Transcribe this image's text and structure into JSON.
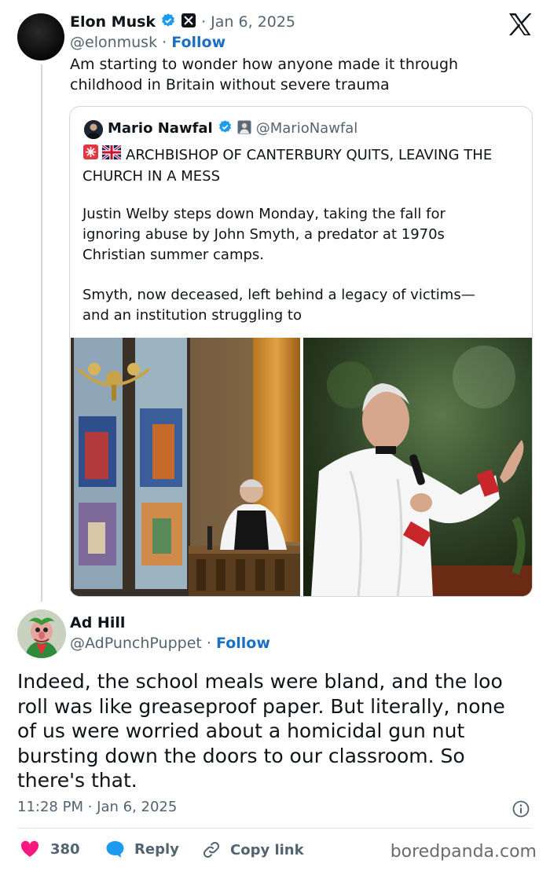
{
  "main_tweet": {
    "name": "Elon Musk",
    "date": "· Jan 6, 2025",
    "handle": "@elonmusk",
    "separator": "·",
    "follow_label": "Follow",
    "text_line1": "Am starting to wonder how anyone made it through",
    "text_line2": "childhood in Britain without severe trauma"
  },
  "quoted_tweet": {
    "name": "Mario Nawfal",
    "handle": "@MarioNawfal",
    "headline_line1": "ARCHBISHOP OF CANTERBURY QUITS, LEAVING THE",
    "headline_line2": "CHURCH IN A MESS",
    "para1_line1": "Justin Welby steps down Monday, taking the fall for",
    "para1_line2": "ignoring abuse by John Smyth, a predator at 1970s",
    "para1_line3": "Christian summer camps.",
    "para2_line1": "Smyth, now deceased, left behind a legacy of victims—",
    "para2_line2": "and an institution struggling to"
  },
  "reply_tweet": {
    "name": "Ad Hill",
    "handle": "@AdPunchPuppet",
    "separator": "·",
    "follow_label": "Follow",
    "text_line1": "Indeed, the school meals were bland, and the loo",
    "text_line2": "roll was like greaseproof paper. But literally, none",
    "text_line3": "of us were worried about a homicidal gun nut",
    "text_line4": "bursting down the doors to our classroom. So",
    "text_line5": "there's that.",
    "timestamp": "11:28 PM · Jan 6, 2025"
  },
  "actions": {
    "likes": "380",
    "reply_label": "Reply",
    "copy_link_label": "Copy link"
  },
  "watermark": "boredpanda.com",
  "colors": {
    "verified_blue": "#1d9bf0",
    "follow_blue": "#1d6fc4",
    "like_pink": "#f91880",
    "muted": "#536471"
  }
}
